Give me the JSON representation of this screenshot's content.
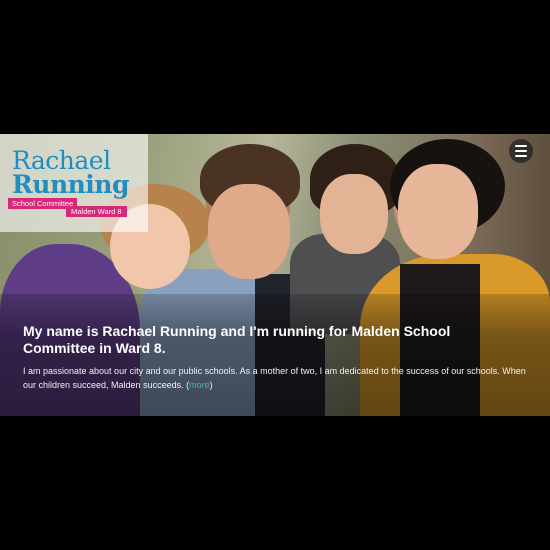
{
  "logo": {
    "first_name": "Rachael",
    "last_name": "Running",
    "tagline": "School Committee",
    "ward": "Malden Ward 8"
  },
  "header": {
    "menu_icon": "hamburger-menu-icon"
  },
  "hero": {
    "headline": "My name is Rachael Running and I'm running for Malden School Committee in Ward 8.",
    "body_before": "I am passionate about our city and our public schools. As a mother of two, I am dedicated to the success of our schools. When our children succeed, Malden succeeds. (",
    "more_link": "more",
    "body_after": ")"
  },
  "colors": {
    "brand_blue": "#1f8fbf",
    "brand_pink": "#d6297a",
    "link_teal": "#41b7a8"
  }
}
